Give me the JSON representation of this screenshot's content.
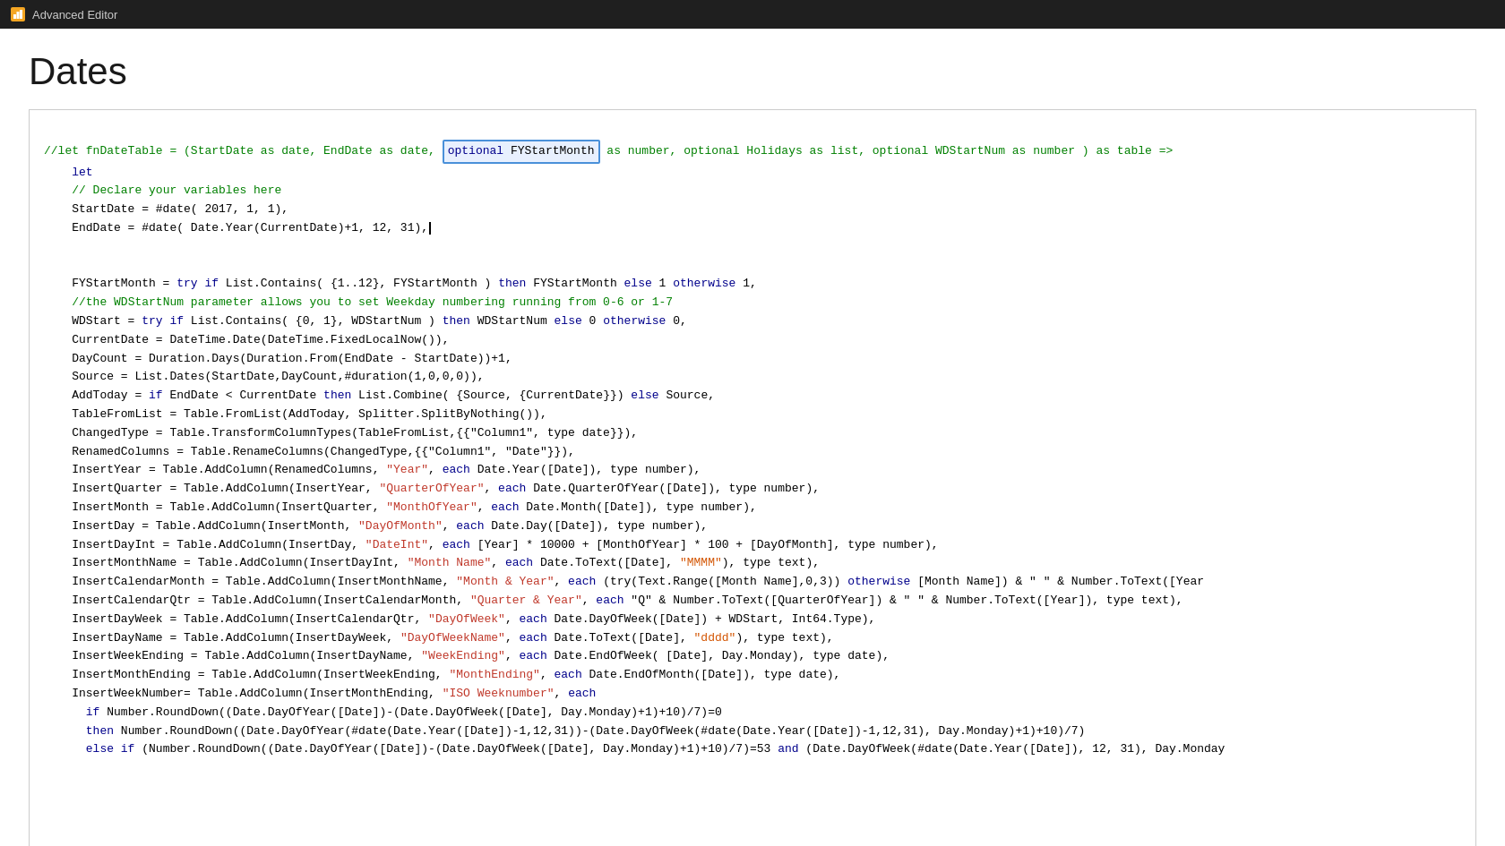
{
  "titleBar": {
    "icon": "chart-icon",
    "title": "Advanced Editor"
  },
  "pageTitle": "Dates",
  "code": {
    "lines": []
  }
}
